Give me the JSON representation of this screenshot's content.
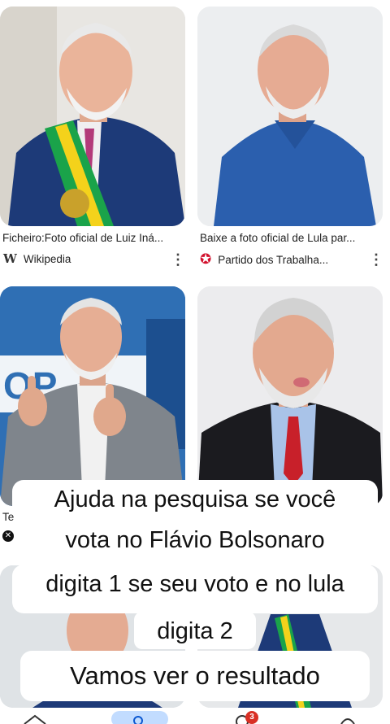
{
  "results": [
    {
      "title": "Ficheiro:Foto oficial de Luiz Iná...",
      "source": "Wikipedia",
      "source_icon": "wikipedia-w-icon"
    },
    {
      "title": "Baixe a foto oficial de Lula par...",
      "source": "Partido dos Trabalha...",
      "source_icon": "pt-star-icon"
    },
    {
      "title": "Te",
      "source": "",
      "source_icon": "x-logo-icon"
    }
  ],
  "overlay_caption": {
    "line1": "Ajuda na pesquisa se você",
    "line2": "vota no Flávio Bolsonaro",
    "line3": "digita 1 se seu voto e no lula",
    "line4": "digita 2",
    "line5": "Vamos ver o resultado"
  },
  "nav": {
    "badge_count": "3"
  },
  "colors": {
    "jacket_navy": "#1d3a78",
    "shirt_blue": "#2b5fae",
    "sash_green": "#1aa34a",
    "sash_yellow": "#f4d21b",
    "tie_red": "#c8202a",
    "pt_red": "#d2122e",
    "badge_red": "#d93025",
    "nav_blue": "#c2dcff"
  }
}
